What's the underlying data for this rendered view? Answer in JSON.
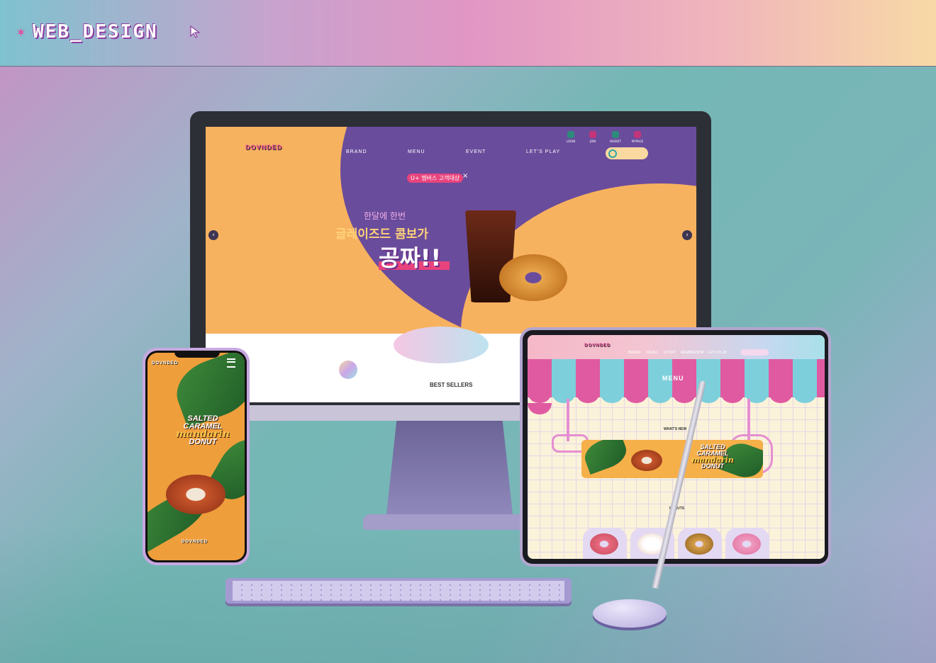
{
  "header": {
    "title": "WEB_DESIGN"
  },
  "desktop_site": {
    "logo": "DOVNDED",
    "nav": [
      "BRAND",
      "MENU",
      "EVENT",
      "LET'S PLAY"
    ],
    "utility": [
      "LOGIN",
      "JOIN",
      "BASKET",
      "MYPAGE"
    ],
    "collab_badge": "U+ 멤버스 고객대상",
    "collab_x": "×",
    "promo_line1": "한달에 한번",
    "promo_line2": "글레이즈드 콤보가",
    "promo_line3": "공짜!!",
    "section_title": "BEST SELLERS",
    "prev_arrow": "‹",
    "next_arrow": "›"
  },
  "phone_site": {
    "logo": "DOVNDED",
    "title_line1": "SALTED",
    "title_line2": "CARAMEL",
    "title_script": "mandarin",
    "title_line3": "DONUT",
    "footer_logo": "DOVNDED"
  },
  "tablet_site": {
    "logo": "DOVNDED",
    "nav": [
      "BRAND",
      "MENU",
      "STORY",
      "MEMBERSHIP",
      "LET'S PLAY"
    ],
    "page_title": "MENU",
    "whats_new": "WHAT'S NEW",
    "banner_line1": "SALTED",
    "banner_line2": "CARAMEL",
    "banner_script": "mandarin",
    "banner_line3": "DONUT",
    "donuts_label": "DONUTS"
  },
  "colors": {
    "accent_pink": "#e8437d",
    "hero_purple": "#6a4c9c",
    "hero_orange": "#f7b25f",
    "teal": "#7ccfdb"
  }
}
